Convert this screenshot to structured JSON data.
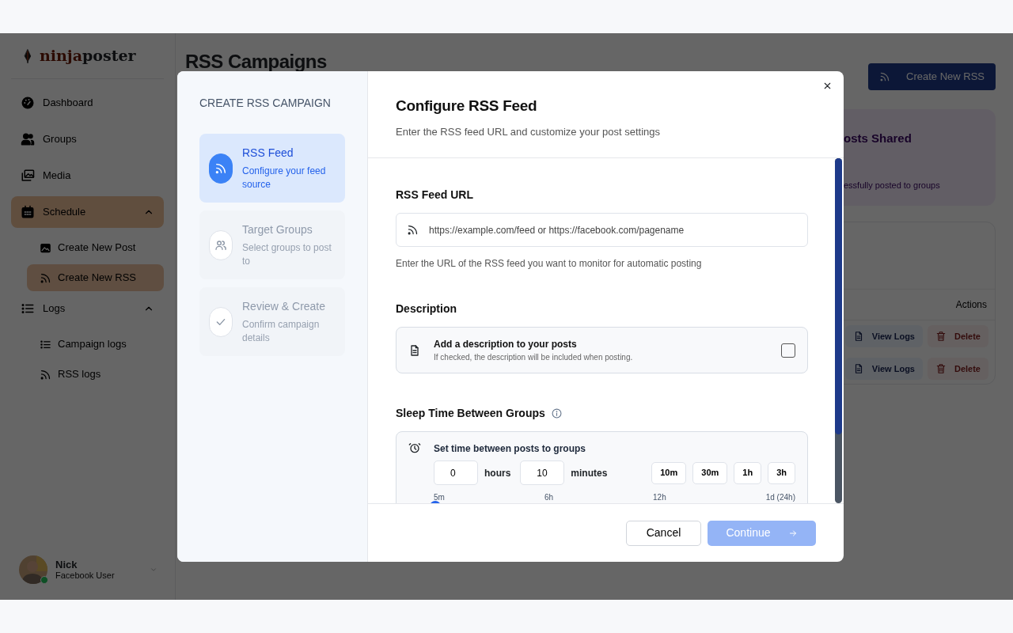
{
  "logo": {
    "accent": "ninja",
    "rest": "poster"
  },
  "sidebar": {
    "items": [
      {
        "label": "Dashboard",
        "selected": false
      },
      {
        "label": "Groups",
        "selected": false
      },
      {
        "label": "Media",
        "selected": false
      },
      {
        "label": "Schedule",
        "selected": true,
        "expanded": true,
        "children": [
          {
            "label": "Create New Post",
            "selected": false
          },
          {
            "label": "Create New RSS",
            "selected": true
          }
        ]
      },
      {
        "label": "Logs",
        "selected": false,
        "expanded": true,
        "children": [
          {
            "label": "Campaign logs",
            "selected": false
          },
          {
            "label": "RSS logs",
            "selected": false
          }
        ]
      }
    ]
  },
  "user": {
    "name": "Nick",
    "role": "Facebook User",
    "online": true
  },
  "page": {
    "title": "RSS Campaigns",
    "create_button": "Create New RSS",
    "stats_card": {
      "title": "osts Shared",
      "caption": "essfully posted to groups"
    },
    "table": {
      "columns": [
        "Actions"
      ],
      "rows": [
        {
          "actions": [
            "View Logs",
            "Delete"
          ]
        },
        {
          "actions": [
            "View Logs",
            "Delete"
          ]
        }
      ]
    }
  },
  "modal": {
    "sidebar_title": "CREATE RSS CAMPAIGN",
    "steps": [
      {
        "title": "RSS Feed",
        "subtitle": "Configure your feed source",
        "selected": true,
        "disabled": false
      },
      {
        "title": "Target Groups",
        "subtitle": "Select groups to post to",
        "selected": false,
        "disabled": true
      },
      {
        "title": "Review & Create",
        "subtitle": "Confirm campaign details",
        "selected": false,
        "disabled": true
      }
    ],
    "title": "Configure RSS Feed",
    "subtitle": "Enter the RSS feed URL and customize your post settings",
    "feed_url": {
      "label": "RSS Feed URL",
      "placeholder": "https://example.com/feed or https://facebook.com/pagename",
      "help": "Enter the URL of the RSS feed you want to monitor for automatic posting"
    },
    "description": {
      "label": "Description",
      "option_title": "Add a description to your posts",
      "option_hint": "If checked, the description will be included when posting.",
      "checked": false
    },
    "sleep": {
      "label": "Sleep Time Between Groups",
      "caption": "Set time between posts to groups",
      "hours": "0",
      "hours_unit": "hours",
      "minutes": "10",
      "minutes_unit": "minutes",
      "presets": [
        "10m",
        "30m",
        "1h",
        "3h"
      ],
      "slider": {
        "ticks": [
          "5m",
          "6h",
          "12h",
          "1d (24h)"
        ],
        "level": 0.004
      }
    },
    "buttons": {
      "cancel": "Cancel",
      "continue": {
        "label": "Continue",
        "disabled": true
      }
    }
  }
}
